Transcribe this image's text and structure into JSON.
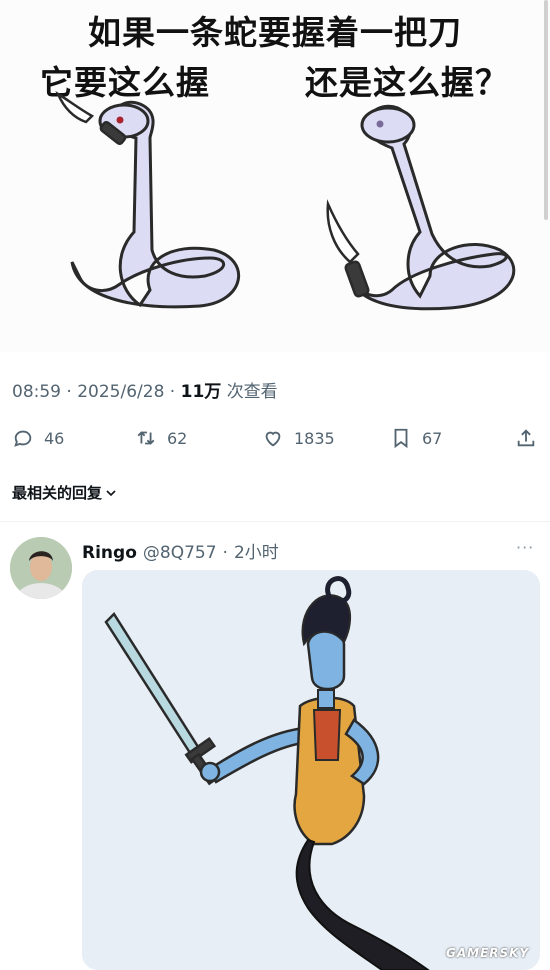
{
  "meme": {
    "line1": "如果一条蛇要握着一把刀",
    "question_left": "它要这么握",
    "question_right": "还是这么握？"
  },
  "tweet_meta": {
    "time": "08:59",
    "date": "2025/6/28",
    "views": "11万",
    "views_label": "次查看"
  },
  "actions": {
    "reply_count": "46",
    "retweet_count": "62",
    "like_count": "1835",
    "bookmark_count": "67"
  },
  "sort": {
    "label": "最相关的回复",
    "icon": "chevron-down-icon"
  },
  "reply": {
    "name": "Ringo",
    "handle": "@8Q757",
    "time": "2小时",
    "more": "···"
  },
  "watermark": "GAMERSKY",
  "colors": {
    "muted": "#536471",
    "text": "#0f1419",
    "snake": "#dcdcf4"
  }
}
